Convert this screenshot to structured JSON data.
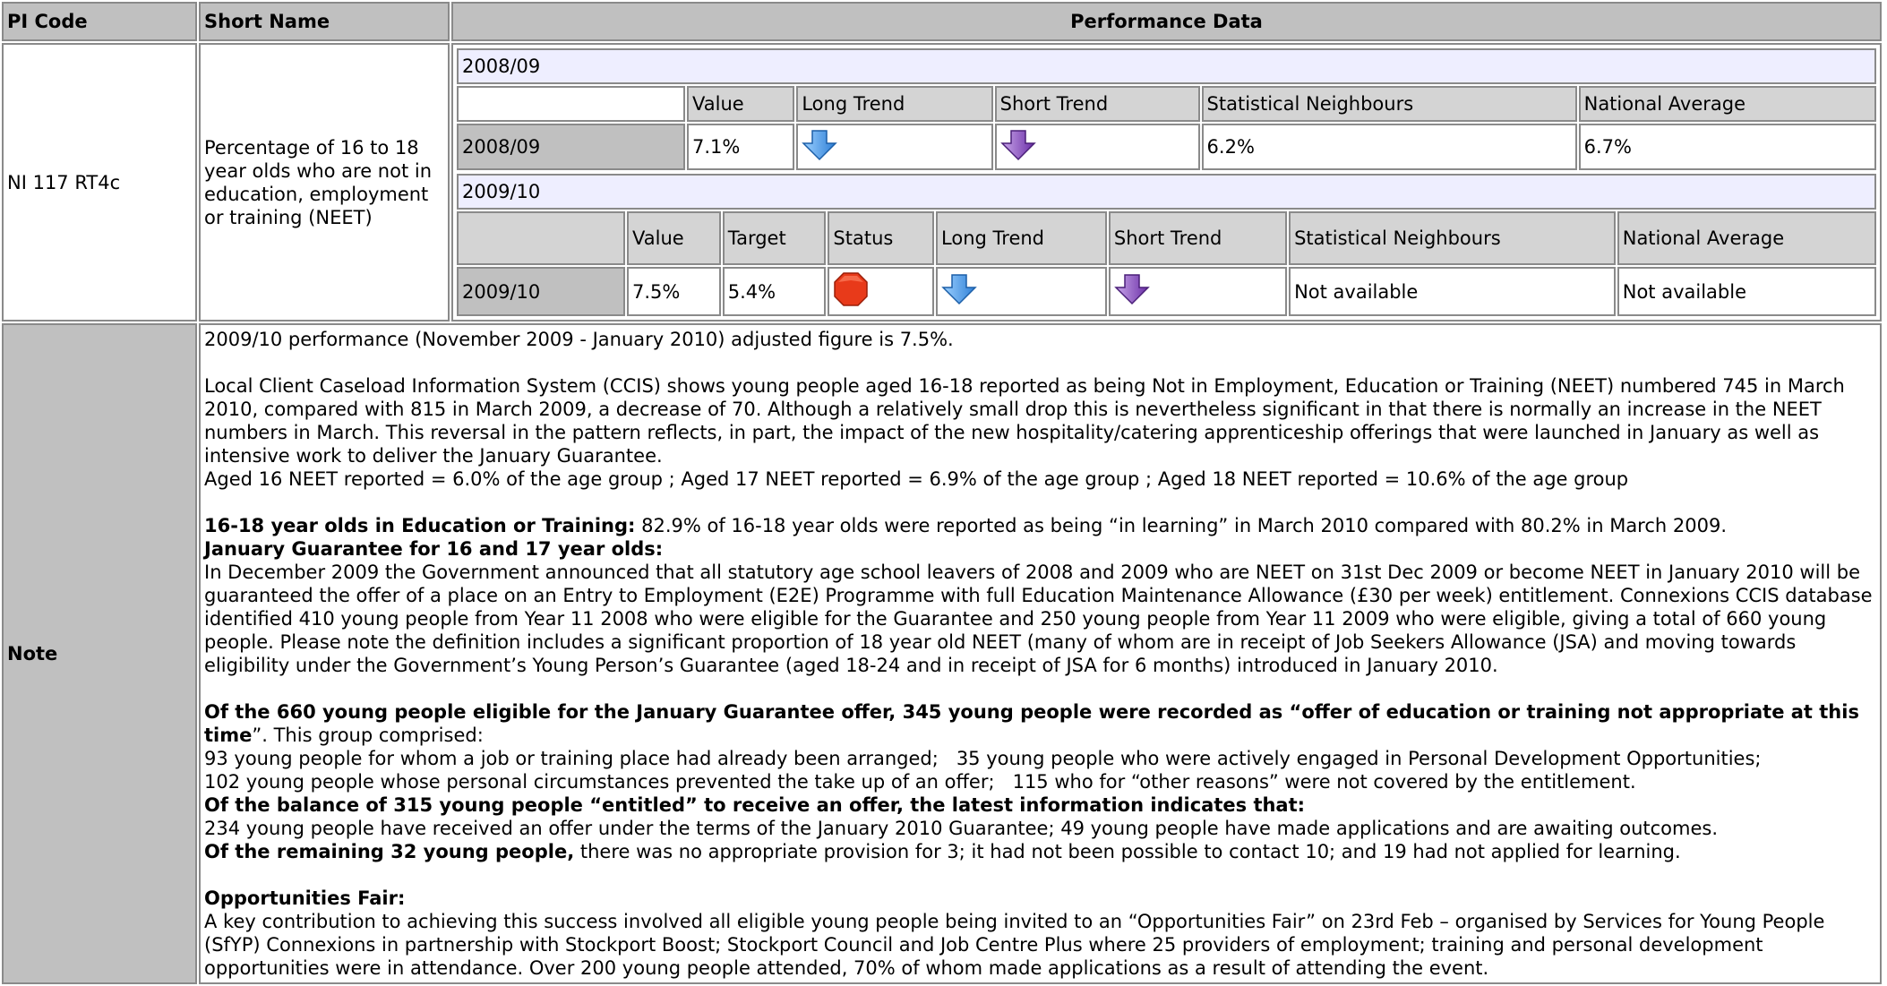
{
  "headers": {
    "pi_code": "PI Code",
    "short_name": "Short Name",
    "performance_data": "Performance Data",
    "note": "Note"
  },
  "pi_code": "NI 117 RT4c",
  "short_name": "Percentage of 16 to 18 year olds who are not in education, employment or training (NEET)",
  "y2008": {
    "year_label": "2008/09",
    "cols": [
      "Value",
      "Long Trend",
      "Short Trend",
      "Statistical Neighbours",
      "National Average"
    ],
    "row_label": "2008/09",
    "value": "7.1%",
    "long_trend_icon": "arrow-down-blue-icon",
    "short_trend_icon": "arrow-down-purple-icon",
    "statistical_neighbours": "6.2%",
    "national_average": "6.7%"
  },
  "y2009": {
    "year_label": "2009/10",
    "cols": [
      "Value",
      "Target",
      "Status",
      "Long Trend",
      "Short Trend",
      "Statistical Neighbours",
      "National Average"
    ],
    "row_label": "2009/10",
    "value": "7.5%",
    "target": "5.4%",
    "status_icon": "red-octagon-status-icon",
    "long_trend_icon": "arrow-down-blue-icon",
    "short_trend_icon": "arrow-down-purple-icon",
    "statistical_neighbours": "Not available",
    "national_average": "Not available"
  },
  "note": {
    "p1": "2009/10 performance (November 2009 - January 2010) adjusted figure is 7.5%.",
    "p2": "Local Client Caseload Information System (CCIS) shows young people aged 16-18 reported as being Not in Employment, Education or Training (NEET) numbered 745 in March 2010, compared with 815 in March 2009, a decrease of 70. Although a relatively small drop this is nevertheless significant in that there is normally an increase in the NEET numbers in March. This reversal in the pattern reflects, in part, the impact of the new hospitality/catering apprenticeship offerings that were launched in January as well as intensive work to deliver the January Guarantee.",
    "p3": "Aged 16 NEET reported = 6.0% of the age group ; Aged 17 NEET reported = 6.9% of the age group ; Aged 18 NEET reported = 10.6% of the age group",
    "p4_bold": "16-18 year olds in Education or Training:",
    "p4_rest": " 82.9% of 16-18 year olds were reported as being “in learning” in March 2010 compared with 80.2% in March 2009.",
    "p5_bold": "January Guarantee for 16 and 17 year olds:",
    "p6": "In December 2009 the Government announced that all statutory age school leavers of 2008 and 2009 who are NEET on 31st Dec 2009 or become NEET in January 2010 will be guaranteed the offer of a place on an Entry to Employment (E2E) Programme with full Education Maintenance Allowance (£30 per week) entitlement. Connexions CCIS database identified 410 young people from Year 11 2008 who were eligible for the Guarantee and 250 young people from Year 11 2009 who were eligible, giving a total of 660 young people. Please note the definition includes a significant proportion of 18 year old NEET (many of whom are in receipt of Job Seekers Allowance (JSA) and moving towards eligibility under the Government’s Young Person’s Guarantee (aged 18-24 and in receipt of JSA for 6 months) introduced in January 2010.",
    "p7_bold": "Of the 660 young people eligible for the January Guarantee offer, 345 young people were recorded as “offer of education or training not appropriate at this time",
    "p7_rest": "”. This group comprised:",
    "p8": "93 young people for whom a job or training place had already been arranged;   35 young people who were actively engaged in Personal Development Opportunities;",
    "p9": "102 young people whose personal circumstances prevented the take up of an offer;   115 who for “other reasons” were not covered by the entitlement.",
    "p10_bold": "Of the balance of 315 young people “entitled” to receive an offer, the latest information indicates that:",
    "p11": "234 young people have received an offer under the terms of the January 2010 Guarantee; 49 young people have made applications and are awaiting outcomes.",
    "p12_bold": "Of the remaining 32 young people,",
    "p12_rest": " there was no appropriate provision for 3; it had not been possible to contact 10; and 19 had not applied for learning.",
    "p13_bold": "Opportunities Fair:",
    "p14": "A key contribution to achieving this success involved all eligible young people being invited to an “Opportunities Fair” on 23rd Feb – organised by Services for Young People (SfYP) Connexions in partnership with Stockport Boost; Stockport Council and Job Centre Plus where 25 providers of employment; training and personal development opportunities were in attendance. Over 200 young people attended, 70% of whom made applications as a result of attending the event."
  },
  "colors": {
    "header_gray": "#c0c0c0",
    "year_band": "#eeeeff",
    "blue_arrow": "#3b8fe0",
    "purple_arrow": "#7a3fb0",
    "status_red": "#e83a1a"
  }
}
